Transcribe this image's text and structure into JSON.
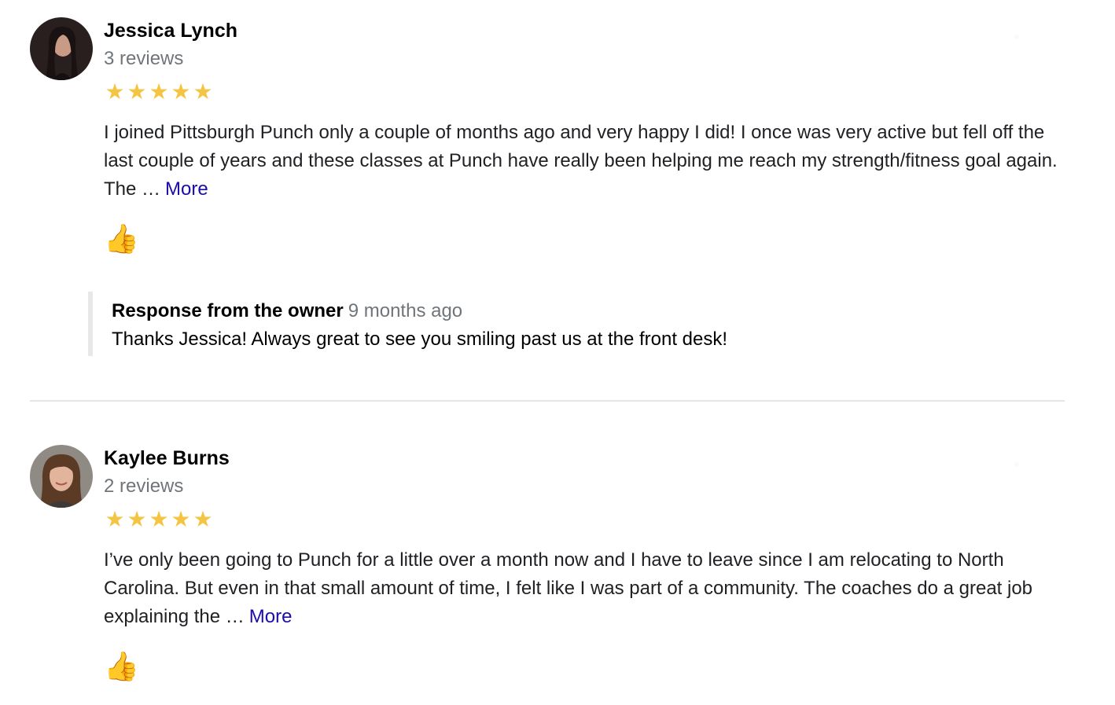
{
  "reviews": [
    {
      "name": "Jessica Lynch",
      "review_count": "3 reviews",
      "rating": 5,
      "stars": "★★★★★",
      "text": "I joined Pittsburgh Punch only a couple of months ago and very happy I did! I once was very active but fell off the last couple of years and these classes at Punch have really been helping me reach my strength/fitness goal again. The …",
      "more_label": "More",
      "owner_response": {
        "label": "Response from the owner",
        "time": "9 months ago",
        "text": "Thanks Jessica! Always great to see you smiling past us at the front desk!"
      }
    },
    {
      "name": "Kaylee Burns",
      "review_count": "2 reviews",
      "rating": 5,
      "stars": "★★★★★",
      "text": "I’ve only been going to Punch for a little over a month now and I have to leave since I am relocating to North Carolina. But even in that small amount of time, I felt like I was part of a community. The coaches do a great job explaining the …",
      "more_label": "More"
    }
  ],
  "colors": {
    "star": "#f4c542",
    "link": "#1a0dab",
    "secondary_text": "#70757a",
    "divider": "#e6e6e6"
  },
  "icons": {
    "like": "thumbs-up-icon",
    "avatar": "user-photo"
  }
}
